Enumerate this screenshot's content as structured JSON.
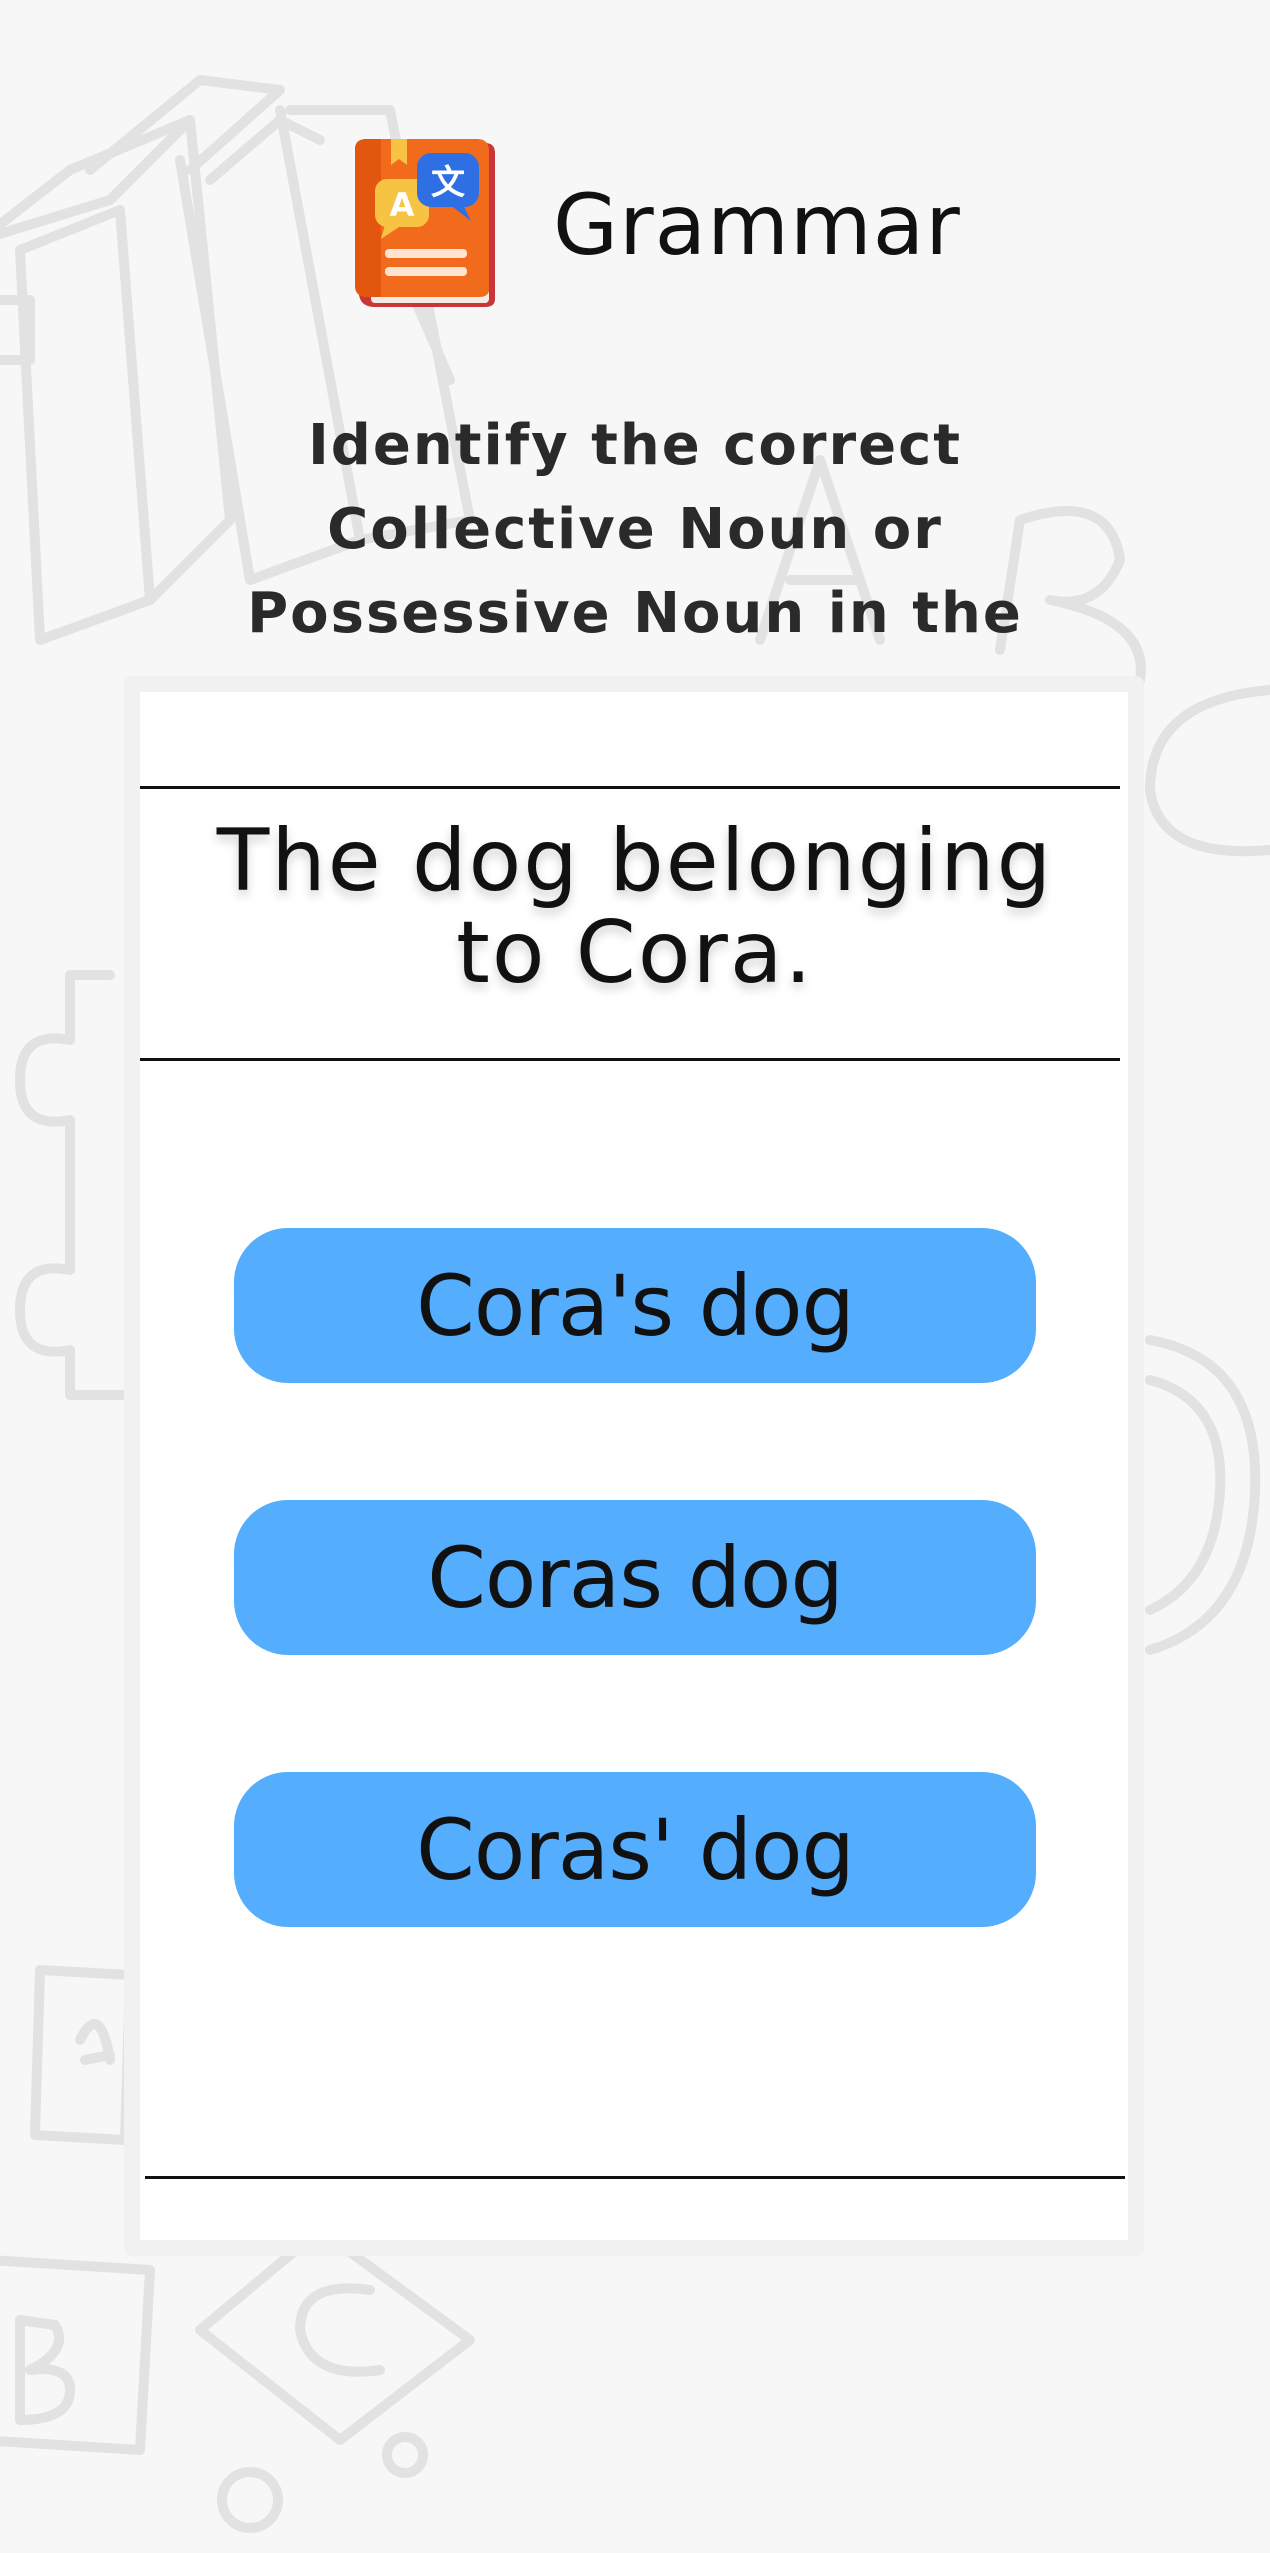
{
  "header": {
    "title": "Grammar",
    "icon": "grammar-book-icon"
  },
  "instruction": "Identify the correct Collective Noun or Possessive Noun in the sentence.",
  "question": {
    "text": "The dog belonging to Cora."
  },
  "options": [
    {
      "label": "Cora's dog"
    },
    {
      "label": "Coras dog"
    },
    {
      "label": "Coras' dog"
    }
  ],
  "colors": {
    "background": "#f7f7f7",
    "card": "#ffffff",
    "option_button": "#55adfd",
    "icon_book": "#f26b1d",
    "icon_bubble_yellow": "#f6c343",
    "icon_bubble_blue": "#2f6fe4"
  }
}
